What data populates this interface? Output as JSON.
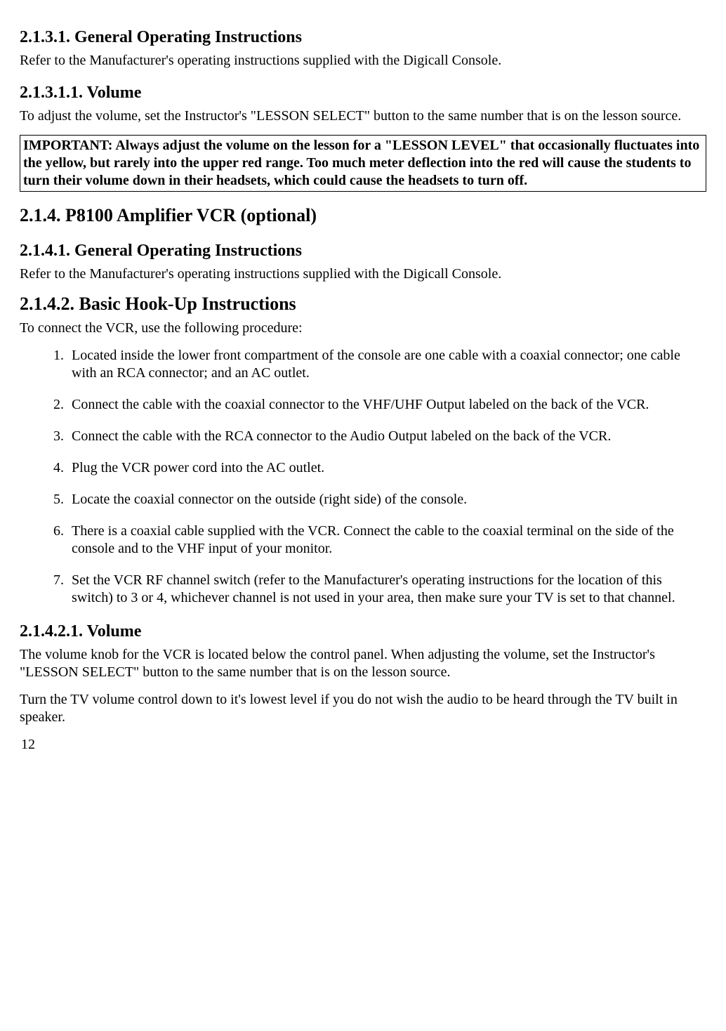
{
  "sections": {
    "s1_heading": "2.1.3.1. General Operating Instructions",
    "s1_para": "Refer to the Manufacturer's operating instructions supplied with the Digicall Console.",
    "s2_heading": "2.1.3.1.1.  Volume",
    "s2_para": "To adjust the volume, set the Instructor's \"LESSON SELECT\" button to the same number that is on the lesson source.",
    "important_box": "IMPORTANT: Always adjust the volume on the lesson for a \"LESSON LEVEL\" that occasionally fluctuates into the yellow, but rarely into the upper red range. Too much meter deflection into the red will cause the students to turn their volume down in their headsets, which could cause the headsets to turn off.",
    "s3_heading": "2.1.4. P8100 Amplifier VCR (optional)",
    "s4_heading": "2.1.4.1. General Operating Instructions",
    "s4_para": "Refer to the Manufacturer's operating instructions supplied with the Digicall Console.",
    "s5_heading": "2.1.4.2. Basic Hook-Up Instructions",
    "s5_para": "To connect the VCR, use the following procedure:",
    "steps": [
      "Located inside the lower front compartment of the console are one cable with a coaxial connector; one cable with an RCA connector; and an AC outlet.",
      "Connect the cable with the coaxial connector to the VHF/UHF Output labeled on the back of the VCR.",
      "Connect the cable with the RCA connector to the Audio Output labeled on the back of the VCR.",
      "Plug the VCR power cord into the AC outlet.",
      "Locate the coaxial connector on the outside (right side) of the console.",
      "There is a coaxial cable supplied with the VCR. Connect the cable to the coaxial terminal on the side of the console and to the VHF input of your monitor.",
      "Set the VCR RF channel switch (refer to the Manufacturer's operating instructions for the location of this switch) to 3 or 4, whichever channel is not used in your area, then make sure your TV is set to that channel."
    ],
    "s6_heading": "2.1.4.2.1.  Volume",
    "s6_para1": "The volume knob for the VCR is located below the control panel. When adjusting the volume, set the Instructor's \"LESSON SELECT\" button to the same number that is on the lesson source.",
    "s6_para2": "Turn the TV volume control down to it's lowest level if you do not wish the audio to be heard through the TV built in speaker."
  },
  "page_number": "12"
}
